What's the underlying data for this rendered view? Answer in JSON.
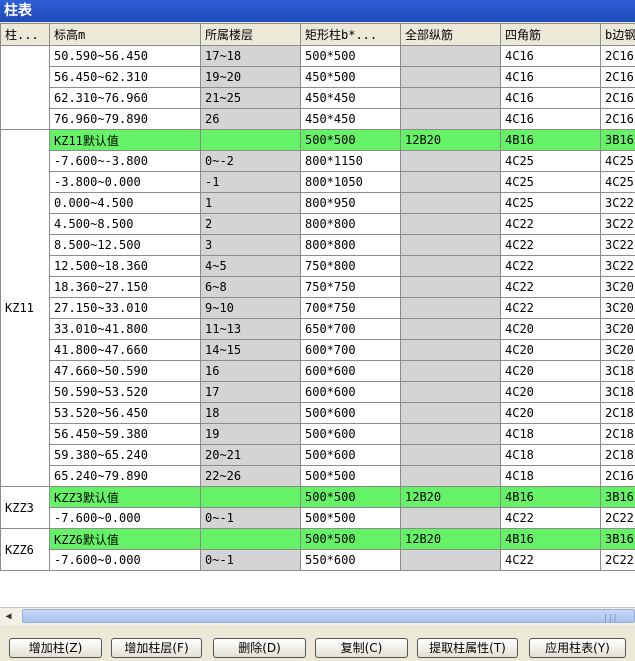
{
  "window": {
    "title": "柱表"
  },
  "columns": [
    "柱...",
    "标高m",
    "所属楼层",
    "矩形柱b*...",
    "全部纵筋",
    "四角筋",
    "b边钢"
  ],
  "groups": [
    {
      "name": "",
      "rows": [
        {
          "cells": [
            "50.590~56.450",
            "17~18",
            "500*500",
            "",
            "4C16",
            "2C16"
          ],
          "default": false
        },
        {
          "cells": [
            "56.450~62.310",
            "19~20",
            "450*500",
            "",
            "4C16",
            "2C16"
          ],
          "default": false
        },
        {
          "cells": [
            "62.310~76.960",
            "21~25",
            "450*450",
            "",
            "4C16",
            "2C16"
          ],
          "default": false
        },
        {
          "cells": [
            "76.960~79.890",
            "26",
            "450*450",
            "",
            "4C16",
            "2C16"
          ],
          "default": false
        }
      ]
    },
    {
      "name": "KZ11",
      "rows": [
        {
          "cells": [
            "KZ11默认值",
            "",
            "500*500",
            "12B20",
            "4B16",
            "3B16"
          ],
          "default": true
        },
        {
          "cells": [
            "-7.600~-3.800",
            "0~-2",
            "800*1150",
            "",
            "4C25",
            "4C25"
          ],
          "default": false
        },
        {
          "cells": [
            "-3.800~0.000",
            "-1",
            "800*1050",
            "",
            "4C25",
            "4C25"
          ],
          "default": false
        },
        {
          "cells": [
            "0.000~4.500",
            "1",
            "800*950",
            "",
            "4C25",
            "3C22"
          ],
          "default": false
        },
        {
          "cells": [
            "4.500~8.500",
            "2",
            "800*800",
            "",
            "4C22",
            "3C22"
          ],
          "default": false
        },
        {
          "cells": [
            "8.500~12.500",
            "3",
            "800*800",
            "",
            "4C22",
            "3C22"
          ],
          "default": false
        },
        {
          "cells": [
            "12.500~18.360",
            "4~5",
            "750*800",
            "",
            "4C22",
            "3C22"
          ],
          "default": false
        },
        {
          "cells": [
            "18.360~27.150",
            "6~8",
            "750*750",
            "",
            "4C22",
            "3C20"
          ],
          "default": false
        },
        {
          "cells": [
            "27.150~33.010",
            "9~10",
            "700*750",
            "",
            "4C22",
            "3C20"
          ],
          "default": false
        },
        {
          "cells": [
            "33.010~41.800",
            "11~13",
            "650*700",
            "",
            "4C20",
            "3C20"
          ],
          "default": false
        },
        {
          "cells": [
            "41.800~47.660",
            "14~15",
            "600*700",
            "",
            "4C20",
            "3C20"
          ],
          "default": false
        },
        {
          "cells": [
            "47.660~50.590",
            "16",
            "600*600",
            "",
            "4C20",
            "3C18"
          ],
          "default": false
        },
        {
          "cells": [
            "50.590~53.520",
            "17",
            "600*600",
            "",
            "4C20",
            "3C18"
          ],
          "default": false
        },
        {
          "cells": [
            "53.520~56.450",
            "18",
            "500*600",
            "",
            "4C20",
            "2C18"
          ],
          "default": false
        },
        {
          "cells": [
            "56.450~59.380",
            "19",
            "500*600",
            "",
            "4C18",
            "2C18"
          ],
          "default": false
        },
        {
          "cells": [
            "59.380~65.240",
            "20~21",
            "500*600",
            "",
            "4C18",
            "2C18"
          ],
          "default": false
        },
        {
          "cells": [
            "65.240~79.890",
            "22~26",
            "500*500",
            "",
            "4C18",
            "2C16"
          ],
          "default": false
        }
      ]
    },
    {
      "name": "KZZ3",
      "rows": [
        {
          "cells": [
            "KZZ3默认值",
            "",
            "500*500",
            "12B20",
            "4B16",
            "3B16"
          ],
          "default": true
        },
        {
          "cells": [
            "-7.600~0.000",
            "0~-1",
            "500*500",
            "",
            "4C22",
            "2C22"
          ],
          "default": false
        }
      ]
    },
    {
      "name": "KZZ6",
      "rows": [
        {
          "cells": [
            "KZZ6默认值",
            "",
            "500*500",
            "12B20",
            "4B16",
            "3B16"
          ],
          "default": true
        },
        {
          "cells": [
            "-7.600~0.000",
            "0~-1",
            "550*600",
            "",
            "4C22",
            "2C22"
          ],
          "default": false
        }
      ]
    }
  ],
  "buttons": [
    {
      "name": "add-column-button",
      "label": "增加柱(Z)"
    },
    {
      "name": "add-floor-button",
      "label": "增加柱层(F)"
    },
    {
      "name": "delete-button",
      "label": "删除(D)"
    },
    {
      "name": "copy-button",
      "label": "复制(C)"
    },
    {
      "name": "extract-props-button",
      "label": "提取柱属性(T)"
    },
    {
      "name": "apply-table-button",
      "label": "应用柱表(Y)"
    }
  ],
  "scrollbar": {
    "left_arrow_icon": "arrow-left-icon"
  },
  "colors": {
    "default_row": "#66F266",
    "gray_cell": "#D4D4D4",
    "title_bar": "#2050C8"
  }
}
